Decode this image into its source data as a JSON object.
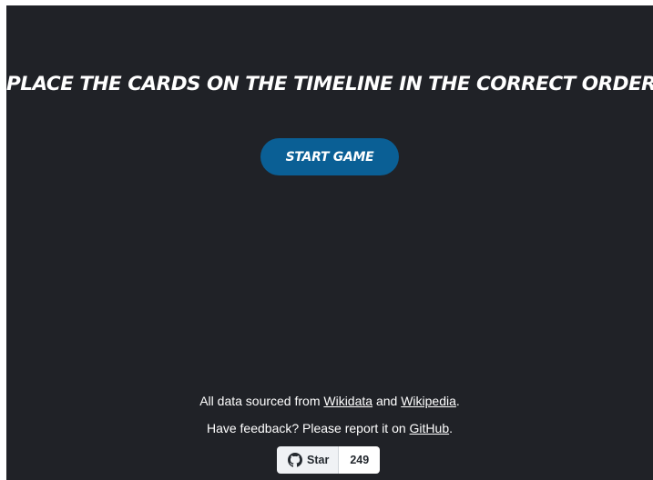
{
  "heading": "PLACE THE CARDS ON THE TIMELINE IN THE CORRECT ORDER.",
  "start_button": "START GAME",
  "footer": {
    "line1_prefix": "All data sourced from ",
    "wikidata_link": "Wikidata",
    "line1_middle": " and ",
    "wikipedia_link": "Wikipedia",
    "line1_suffix": ".",
    "line2_prefix": "Have feedback? Please report it on ",
    "github_link": "GitHub",
    "line2_suffix": "."
  },
  "github_widget": {
    "star_label": "Star",
    "star_count": "249",
    "icon": "github-icon"
  },
  "colors": {
    "background": "#202227",
    "button": "#0a5f95",
    "text": "#ffffff"
  }
}
